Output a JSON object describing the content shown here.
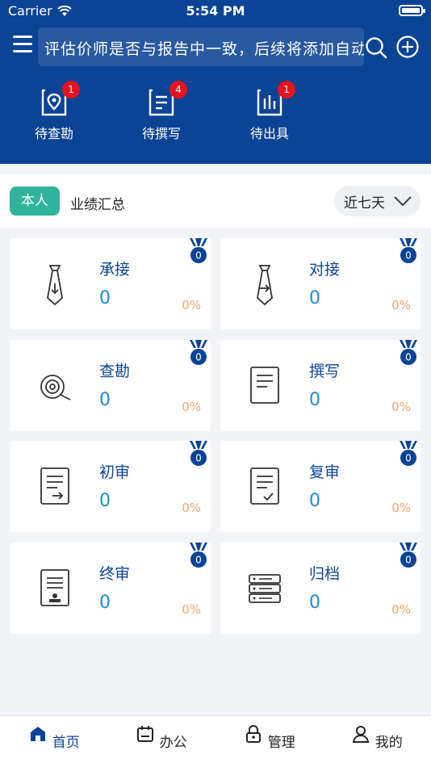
{
  "status": {
    "carrier": "Carrier",
    "time": "5:54 PM"
  },
  "header": {
    "marquee_text": "评估价师是否与报告中一致，后续将添加自动生成",
    "quick_items": [
      {
        "label": "待查勘",
        "badge": "1",
        "icon": "location-doc-icon"
      },
      {
        "label": "待撰写",
        "badge": "4",
        "icon": "list-doc-icon"
      },
      {
        "label": "待出具",
        "badge": "1",
        "icon": "chart-doc-icon"
      }
    ]
  },
  "summary": {
    "scope": "本人",
    "title": "业绩汇总",
    "range": "近七天"
  },
  "cards": [
    {
      "title": "承接",
      "value": "0",
      "pct": "0%",
      "medal": "0",
      "icon": "tie-down-icon"
    },
    {
      "title": "对接",
      "value": "0",
      "pct": "0%",
      "medal": "0",
      "icon": "tie-right-icon"
    },
    {
      "title": "查勘",
      "value": "0",
      "pct": "0%",
      "medal": "0",
      "icon": "magnifier-icon"
    },
    {
      "title": "撰写",
      "value": "0",
      "pct": "0%",
      "medal": "0",
      "icon": "document-icon"
    },
    {
      "title": "初审",
      "value": "0",
      "pct": "0%",
      "medal": "0",
      "icon": "doc-arrow-icon"
    },
    {
      "title": "复审",
      "value": "0",
      "pct": "0%",
      "medal": "0",
      "icon": "doc-check-icon"
    },
    {
      "title": "终审",
      "value": "0",
      "pct": "0%",
      "medal": "0",
      "icon": "doc-stamp-icon"
    },
    {
      "title": "归档",
      "value": "0",
      "pct": "0%",
      "medal": "0",
      "icon": "archive-icon"
    }
  ],
  "tabs": [
    {
      "label": "首页",
      "icon": "home-icon",
      "active": true
    },
    {
      "label": "办公",
      "icon": "calendar-icon",
      "active": false
    },
    {
      "label": "管理",
      "icon": "lock-icon",
      "active": false
    },
    {
      "label": "我的",
      "icon": "user-icon",
      "active": false
    }
  ],
  "colors": {
    "primary": "#0b4395",
    "accent": "#2fb39a",
    "value": "#1c8cd6",
    "percent": "#f5a46a",
    "badge": "#e8121f"
  }
}
